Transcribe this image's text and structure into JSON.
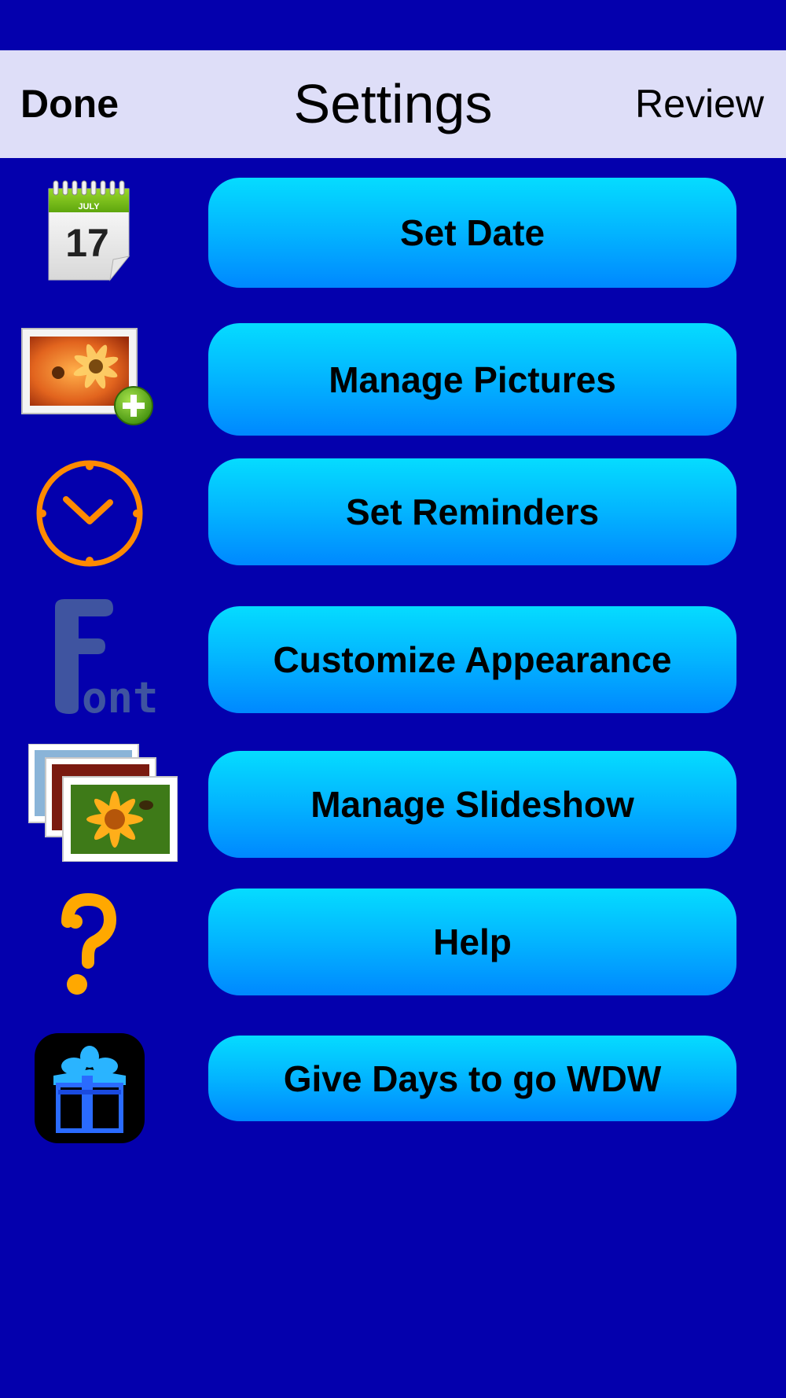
{
  "nav": {
    "done_label": "Done",
    "title": "Settings",
    "review_label": "Review"
  },
  "calendar_icon": {
    "month": "JULY",
    "day": "17"
  },
  "font_icon": {
    "big_letter": "F",
    "rest": "ont"
  },
  "menu": [
    {
      "label": "Set Date",
      "icon": "calendar-icon"
    },
    {
      "label": "Manage Pictures",
      "icon": "add-picture-icon"
    },
    {
      "label": "Set Reminders",
      "icon": "clock-icon"
    },
    {
      "label": "Customize Appearance",
      "icon": "font-icon"
    },
    {
      "label": "Manage Slideshow",
      "icon": "slideshow-photos-icon"
    },
    {
      "label": "Help",
      "icon": "question-mark-icon"
    },
    {
      "label": "Give Days to go WDW",
      "icon": "gift-icon"
    }
  ],
  "colors": {
    "background": "#0400ad",
    "nav_bar": "#dedef8",
    "button_top": "#05dcff",
    "button_bottom": "#0088ff",
    "accent_orange": "#ff8a00"
  }
}
